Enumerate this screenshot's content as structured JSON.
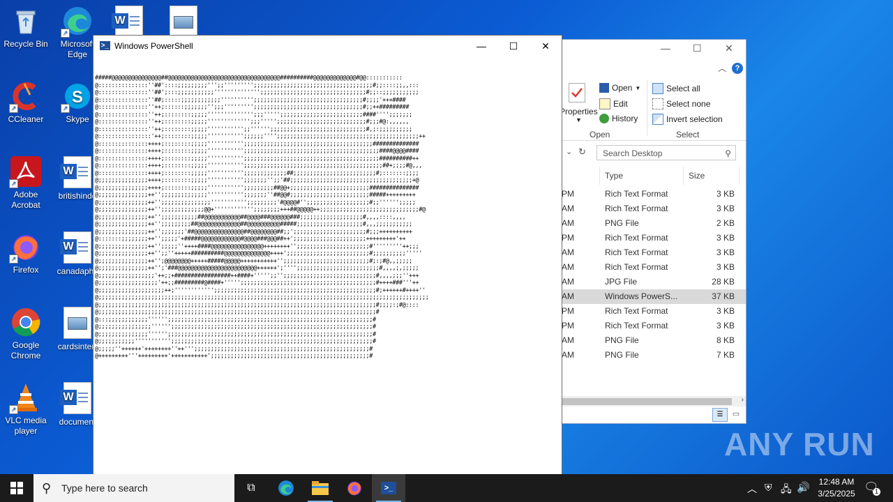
{
  "desktop": {
    "icons": [
      {
        "label": "Recycle Bin"
      },
      {
        "label": "Microsoft Edge"
      },
      {
        "label": "CCleaner"
      },
      {
        "label": "Skype"
      },
      {
        "label": "Adobe Acrobat"
      },
      {
        "label": "britishinde"
      },
      {
        "label": "Firefox"
      },
      {
        "label": "canadaphc"
      },
      {
        "label": "Google Chrome"
      },
      {
        "label": "cardsinterr"
      },
      {
        "label": "VLC media player"
      },
      {
        "label": "document"
      }
    ]
  },
  "powershell": {
    "title": "Windows PowerShell",
    "minimize": "—",
    "maximize": "☐",
    "close": "✕",
    "console_lines": [
      "#####@@@@@@@@@@@@@@@##@@@@@@@@@@@@@@@@@@@@@@@@@@@@@@@@@@##########@@@@@@@@@@@@@#@@:::::::::::",
      "@:::::::::::::::''##'::::;;;;;;;;;''';;''''''''';;;;;;;;;;;;;;;;;;;;;;;;;;;;;;;;;;;;#;;::::;;,,:::",
      "@:::::::::::::::''##';:::;;;;;;;;;;;'''''''''''''';;;;;;;;;;;;;;;;;;;;;;;;;;;;;;;;#;;::;;;;;;;;;;;",
      "@:::::::::::::::''##;:::::;;;;;;;;;;;;'''''''''';;;;;;;;;;;;;;;;;;;;;;;;;;;;;;;;;#;;;;'+++####",
      "@:::::::::::::::''++;::::::;;;;;;;'';;;''''''''';;;;;;;;;;;;;;;;;;;;;;;;;;;;;;;;;#;;++#########",
      "@:::::::::::::::''++;::::::::;;;;;'''''''''''''';;;''''';;;;;;;;;;;;;;;;;;;;;;;;;####'''';;;;;;;",
      "@:::::::::::::::''++;::::::::;;;;;''''''''''''';;;''''';;;;;;;;;;;;;;;;;;;;;;;;;;;#;;;#@:,,,,,,",
      "@:::::::::::::::''++;::::::::;;;;;''''''''''';;'''''';;;;;;;;;;;;;;;;;;;;;;;;;;;;;#,;:;;;;;;;;;;",
      "@::::::::::::::::'++;::::::::;;;;;''''''''''';;;;;;'''';;;;;;;;;;;;;;;;;;;;;;;;;;;;;;;;;;;;;;;;;;;++",
      "@:::::::::::::::++++;::::::::;;;;;''''''''''';;;;;;;;;;;;;;;;;;;;;;;;;;;;;;;;;;;;;;;##############",
      "@:::::::::::::::++++;::::::::;;;;;''''''''''';;;;;;;;;;;;;;;;;;;;;;;;;;;;;;;;;;;;;;;;;####@@@@####",
      "@:::::::::::::::++++;::::::::;;;;;''''''''''';;;;;;;;;;;;;;;;;;;;;;;;;;;;;;;;;;;;;;;;;##########++",
      "@:::::::::::::::++++;::::::::;;;;;''''''''''';;;;;;;;;;;;;;;;;;;;;;;;;;;;;;;;;;;;;;;;;;##+;;;;#@,,,",
      "@:::::::::::::::++++;::::::::;;;;;''''''''''';;;;;;;;;;;;;##;;;;;;;;;;;;;;;;;;;;;;;;;#;:::::::;;;;",
      "@;;;;;;;;;;;;;;;++++;::::::::;;;;;''''''''''';;;;;;;'';;'##;;;;;;;;;;;;;;;;;;;;;;;;;;;;;;;;;;;;;+@",
      "@;;;;;;;;;;;;;;;++++;::::::::;;;;;''''''''''';;;;;;;;;##@@+;;;;;;;;;;;;;;;;;;;;;;;;###############",
      "@;;;;;;;;;;;;;;;++'';;;;;;;;;;;;;;''''''''''';;;;;;;''##@@#;;;;;;;;;;;;;;;;;;;;;;;;#####+++++++++",
      "@;;;;;;;;;;;;;;;++'';;;;;;;;;;;;;;;''''''''''';;;;;;;;;'#@@@@#'';;;;;;;;;;;;;;;;;;;#;;'''''';;;;;",
      "@;;;;;;;;;;;;;;;++'';;;;;;;;;;;;;@@+'''''''''''';;;;;;;;+++##@@@@@++;;;;;;;;;;;;;;;;;;;;;;;;;;;;;;#@",
      "@;;;;;;;;;;;;;;;++'';;;;;;;;;;;##@@@@@@@@@@@##@@@@###@@@@@@###;;;;;;;;;;;;;;;;;;;#,,,,::::,,,,",
      "@;;;;;;;;;;;;;;;++'';;;;;;;;;##@@@@@@@@@@@@@##@@@@@@@@@@#####;;;;;;;;;;;;;;;;;;;;#,,,;;;;;;;;;;;",
      "@;;;;;;;;;;;;;;;++'';;;;;;;'##@@@@@@@@@@@@@@@##@@@@@@@@##;;';;;;;;;;;;;;;;;;;;;;;;#;;;++++++++++",
      "@:::::::;;;;;;;;++'';;;;;'+#####@@@@@@@@@@@@#@@@@###@@@##++';;;;;;;;;;;;;;;;;;;;;;+++++++++'++",
      "@;;;;;;;;;;;;;;;++'';;;;;''++++####@@@@@@@@@@@@@@@@++++++++'';;;;;;;;;;;;;;;;;;;;;;#'''''''''++;;;",
      "@;;;;;;;;;;;;;;;++'';;''+++++##########@@@@@@@@@@@@@@++++';;;;;;;;;;;;;;;;;;;;;;;;;#;;;;;;;;;;'''''",
      "@;;;;;;;;;;;;;;;++'';@@@@@@@@+++++#####@@@@@+++++++++++'';;;;;;;;;;;;;;;;;;;;;;;;;;#;:;#@,,;;;;;",
      "@;;;;;;;;;;;;;;;++'';'###@@@@@@@@@@@@@@@@@@@@@@@@++++++';'''';;;;;;;;;;;;;;;;;;;;;;;;;#,,,,;,;;;;;",
      "@;;;;;;;;;;;;;;;;;'++;;+#################++####+''''';;'';;;;;;;;;;;;;;;;;;;;;;;;;;;;#,,,,;;;''+++",
      "@;;;;;;;;;;;;;;;;;;'++;;#########@####+''''';;;;;;;;;;;;;;;;;;;;;;;;;;;;;;;;;;;;;;;;;#++++###'''++",
      "@;;;;;;;;;;;;;;;;;;;;++;'''''''''''';;;;;;;;;;;;;;;;;;;;;;;;;;;;;;;;;;;;;;;;;;;;;;;;;#;++++++#++++''",
      "@;;;;;;;;;;;;;;;;;;;;;;;;;;;;;;;;;;;;;;;;;;;;;;;;;;;;;;;;;;;;;;;;;;;;;;;;;;;;;;;;;;;;;;;;;;;;;;;;;;;;",
      "@;;;;;;;;;;;;;;;;;;;;;;;;;;;;;;;;;;;;;;;;;;;;;;;;;;;;;;;;;;;;;;;;;;;;;;;;;;;;;;;;;;;;#;;;;:;#@::::",
      "@;;;;;;;;;;;;;;;;;;;;;;;;;;;;;;;;;;;;;;;;;;;;;;;;;;;;;;;;;;;;;;;;;;;;;;;;;;;;;;;;;;;;#",
      "@:::;;;;;;;;;;;;'''''';;;;;;;;;;;;;;;;;;;;;;;;;;;;;;;;;;;;;;;;;;;;;;;;;;;;;;;;;;;;;;#",
      "@;;;;;;;;;;;;;;;;'''''';;;;;;;;;;;;;;;;;;;;;;;;;;;;;;;;;;;;;;;;;;;;;;;;;;;;;;;;;;;;;#",
      "@;;;;;;;;;;;;;;;'''''';;;;;;;;;;;;;;;;;;;;;;;;;;;;;;;;;;;;;;;;;;;;;;;;;;;;;;;;;;;;;;#",
      "@;;;;;;;;;;;''''''''''';;;;;;;;;;;;;;;;;;;;;;;;;;;;;;;;;;;;;;;;;;;;;;;;;;;;;;;;;;;;;#",
      "@;;;;;''++++++'++++++++''++''';;;;;;;;;;;;;;;;;;;;;;;;;;;;;;;;;;;;;;;;;;;;;;;;;;;;;#",
      "@+++++++++'''+++++++++'+++++++++++';;;;;;;;;;;;;;;;;;;;;;;;;;;;;;;;;;;;;;;;;;;;;;;;#"
    ]
  },
  "explorer": {
    "ribbon": {
      "properties": "Properties",
      "open": "Open",
      "edit": "Edit",
      "history": "History",
      "select_all": "Select all",
      "select_none": "Select none",
      "invert_selection": "Invert selection",
      "group_open": "Open",
      "group_select": "Select"
    },
    "search_placeholder": "Search Desktop",
    "columns": {
      "type": "Type",
      "size": "Size"
    },
    "rows": [
      {
        "time": "PM",
        "type": "Rich Text Format",
        "size": "3 KB"
      },
      {
        "time": "AM",
        "type": "Rich Text Format",
        "size": "3 KB"
      },
      {
        "time": "AM",
        "type": "PNG File",
        "size": "2 KB"
      },
      {
        "time": "PM",
        "type": "Rich Text Format",
        "size": "3 KB"
      },
      {
        "time": "AM",
        "type": "Rich Text Format",
        "size": "3 KB"
      },
      {
        "time": "AM",
        "type": "Rich Text Format",
        "size": "3 KB"
      },
      {
        "time": "AM",
        "type": "JPG File",
        "size": "28 KB"
      },
      {
        "time": "AM",
        "type": "Windows PowerS...",
        "size": "37 KB",
        "selected": true
      },
      {
        "time": "PM",
        "type": "Rich Text Format",
        "size": "3 KB"
      },
      {
        "time": "PM",
        "type": "Rich Text Format",
        "size": "3 KB"
      },
      {
        "time": "AM",
        "type": "PNG File",
        "size": "8 KB"
      },
      {
        "time": "AM",
        "type": "PNG File",
        "size": "7 KB"
      }
    ]
  },
  "taskbar": {
    "search_placeholder": "Type here to search",
    "time": "12:48 AM",
    "date": "3/25/2025",
    "notification_count": "1"
  },
  "watermark": "ANY RUN",
  "colors": {
    "accent": "#0078d7",
    "taskbar": "#1b1b1b",
    "desktop": "#0b5bd3"
  }
}
